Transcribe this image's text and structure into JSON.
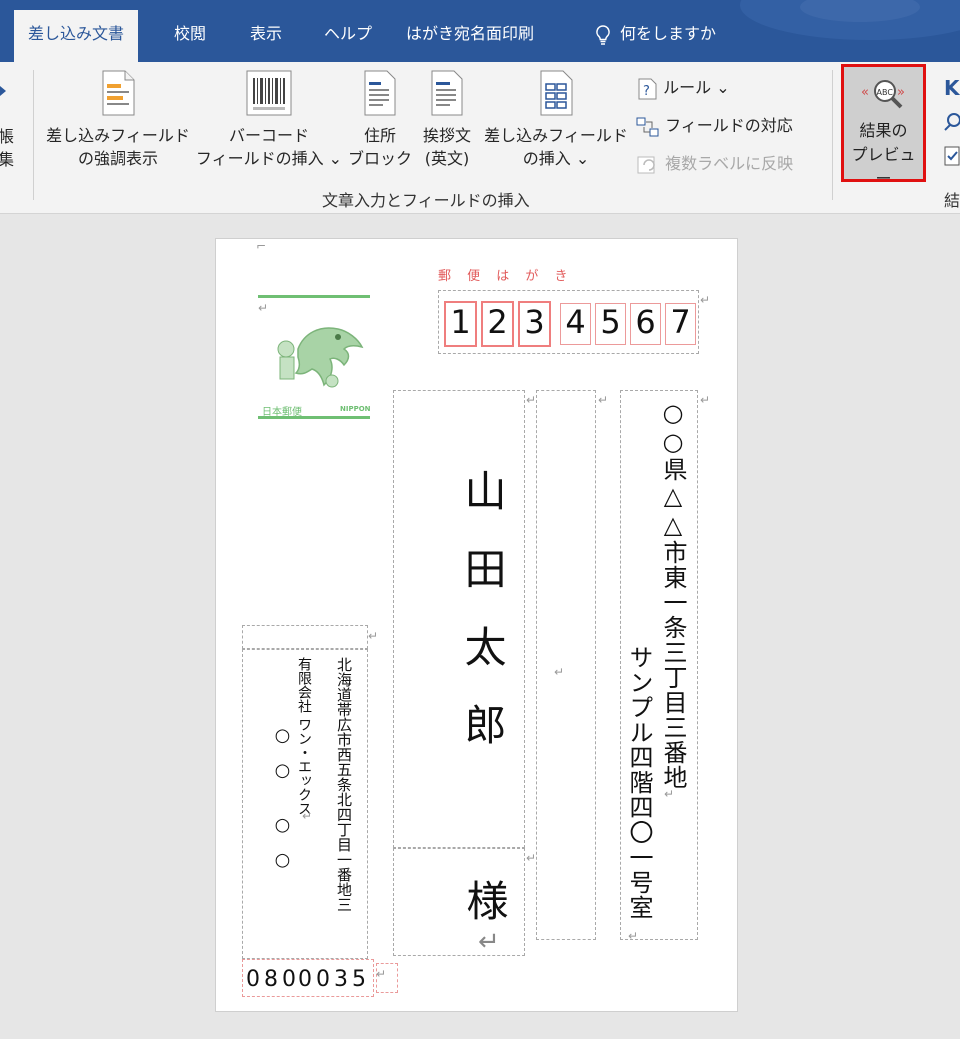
{
  "tabs": [
    "差し込み文書",
    "校閲",
    "表示",
    "ヘルプ",
    "はがき宛名面印刷",
    "何をしますか"
  ],
  "ribbon": {
    "left_partial": "帳\n集",
    "highlight_fields": "差し込みフィールド\nの強調表示",
    "barcode": "バーコード\nフィールドの挿入",
    "address_block": "住所\nブロック",
    "greeting": "挨拶文\n(英文)",
    "insert_field": "差し込みフィールド\nの挿入",
    "rules": "ルール",
    "match_fields": "フィールドの対応",
    "update_labels": "複数ラベルに反映",
    "group_label": "文章入力とフィールドの挿入",
    "preview": "結果の\nプレビュー",
    "right_group_partial": "結"
  },
  "postcard": {
    "header": "郵 便 は が き",
    "zip_digits": [
      "1",
      "2",
      "3",
      "4",
      "5",
      "6",
      "7"
    ],
    "recipient_name": "山田太郎",
    "honorific": "様",
    "address_line1": "○○県△△市東一条三丁目三番地",
    "address_line2": "サンプル四階四〇一号室",
    "sender_address": "北海道帯広市西五条北四丁目一番地三",
    "sender_company": "有限会社 ワン・エックス",
    "sender_name": "○○ ○○",
    "sender_zip": [
      "0",
      "8",
      "0",
      "0",
      "0",
      "3",
      "5"
    ],
    "stamp_text_left": "日本郵便",
    "stamp_text_right": "NIPPON"
  },
  "colors": {
    "tab_bar": "#2b579a",
    "ribbon": "#f3f3f3",
    "zip_box": "#ef7e7e",
    "stamp_green": "#6fbf73"
  }
}
